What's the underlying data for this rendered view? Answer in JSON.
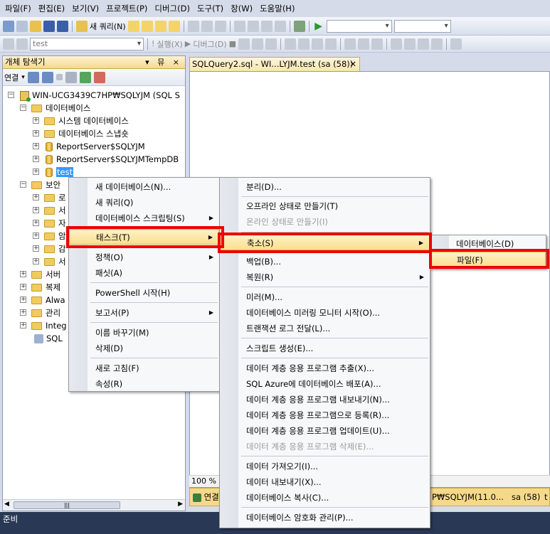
{
  "menubar": [
    "파일(F)",
    "편집(E)",
    "보기(V)",
    "프로젝트(P)",
    "디버그(D)",
    "도구(T)",
    "창(W)",
    "도움말(H)"
  ],
  "toolbar1": {
    "new_query": "새 쿼리(N)"
  },
  "toolbar2": {
    "database_combo": "test",
    "execute": "실행(X)",
    "debug": "디버그(D)"
  },
  "object_explorer": {
    "title": "개체 탐색기",
    "pin": "▾ 뮤 ×",
    "connect": "연결",
    "tree": [
      {
        "label": "WIN-UCG3439C7HP₩SQLYJM (SQL S"
      },
      {
        "label": "데이터베이스"
      },
      {
        "label": "시스템 데이터베이스"
      },
      {
        "label": "데이터베이스 스냅숏"
      },
      {
        "label": "ReportServer$SQLYJM"
      },
      {
        "label": "ReportServer$SQLYJMTempDB"
      },
      {
        "label": "test"
      },
      {
        "label": "보안"
      },
      {
        "label": "로"
      },
      {
        "label": "서"
      },
      {
        "label": "자"
      },
      {
        "label": "암"
      },
      {
        "label": "감"
      },
      {
        "label": "서"
      },
      {
        "label": "서버"
      },
      {
        "label": "복제"
      },
      {
        "label": "Alwa"
      },
      {
        "label": "관리"
      },
      {
        "label": "Integ"
      },
      {
        "label": "SQL"
      }
    ]
  },
  "editor": {
    "tab": "SQLQuery2.sql - WI...LYJM.test (sa (58))",
    "zoom": "100 %",
    "status_left": "연결",
    "status_server": "P₩SQLYJM(11.0...",
    "status_user": "sa (58)",
    "status_t": "t"
  },
  "statusbar": "준비",
  "menu1": {
    "items": [
      "새 데이터베이스(N)...",
      "새 쿼리(Q)",
      "데이터베이스 스크립팅(S)",
      "태스크(T)",
      "정책(O)",
      "패싯(A)",
      "PowerShell 시작(H)",
      "보고서(P)",
      "이름 바꾸기(M)",
      "삭제(D)",
      "새로 고침(F)",
      "속성(R)"
    ]
  },
  "menu2": {
    "items": [
      "분리(D)...",
      "오프라인 상태로 만들기(T)",
      "온라인 상태로 만들기(I)",
      "축소(S)",
      "백업(B)...",
      "복원(R)",
      "미러(M)...",
      "데이터베이스 미러링 모니터 시작(O)...",
      "트랜잭션 로그 전달(L)...",
      "스크립트 생성(E)...",
      "데이터 계층 응용 프로그램 추출(X)...",
      "SQL Azure에 데이터베이스 배포(A)...",
      "데이터 계층 응용 프로그램 내보내기(N)...",
      "데이터 계층 응용 프로그램으로 등록(R)...",
      "데이터 계층 응용 프로그램 업데이트(U)...",
      "데이터 계층 응용 프로그램 삭제(E)...",
      "데이터 가져오기(I)...",
      "데이터 내보내기(X)...",
      "데이터베이스 복사(C)...",
      "데이터베이스 암호화 관리(P)..."
    ]
  },
  "menu3": {
    "items": [
      "데이터베이스(D)",
      "파일(F)"
    ]
  },
  "colors": {
    "highlight_border": "#ee0000",
    "selection": "#3399ff",
    "status_bg": "#293955"
  }
}
